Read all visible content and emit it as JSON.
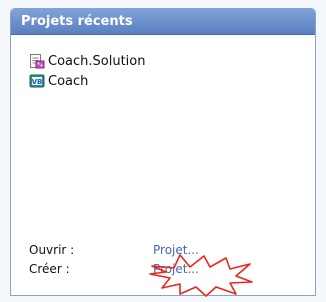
{
  "panel": {
    "title": "Projets récents",
    "recent_projects": [
      {
        "name": "Coach.Solution",
        "icon": "solution-file-icon"
      },
      {
        "name": "Coach",
        "icon": "vb-project-icon"
      }
    ],
    "actions": [
      {
        "label": "Ouvrir :",
        "link": "Projet..."
      },
      {
        "label": "Créer :",
        "link": "Projet..."
      }
    ],
    "colors": {
      "header": "#6e93d0",
      "link": "#4a68b0",
      "highlight": "#e8271c"
    }
  }
}
